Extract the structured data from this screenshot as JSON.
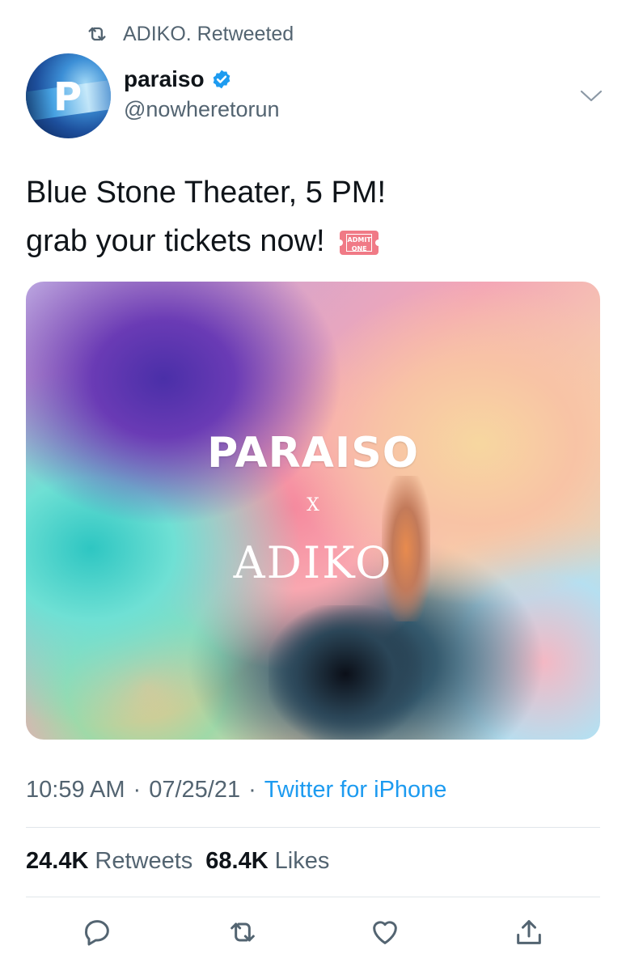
{
  "retweet_banner": {
    "text": "ADIKO. Retweeted",
    "icon": "retweet-icon"
  },
  "author": {
    "display_name": "paraiso",
    "handle": "@nowheretorun",
    "verified": true,
    "avatar_letter": "P"
  },
  "tweet": {
    "line1": "Blue Stone Theater, 5 PM!",
    "line2": "grab your tickets now!",
    "emoji_ticket_text": "ADMIT ONE"
  },
  "media": {
    "title_line1": "PARAISO",
    "title_line2": "X",
    "title_line3": "ADIKO"
  },
  "meta": {
    "time": "10:59 AM",
    "separator": "·",
    "date": "07/25/21",
    "source": "Twitter for iPhone"
  },
  "stats": {
    "retweets_count": "24.4K",
    "retweets_label": "Retweets",
    "likes_count": "68.4K",
    "likes_label": "Likes"
  },
  "actions": [
    "reply-icon",
    "retweet-icon",
    "like-icon",
    "share-icon"
  ],
  "colors": {
    "accent": "#1d9bf0",
    "muted": "#536471",
    "text": "#0f1419"
  }
}
